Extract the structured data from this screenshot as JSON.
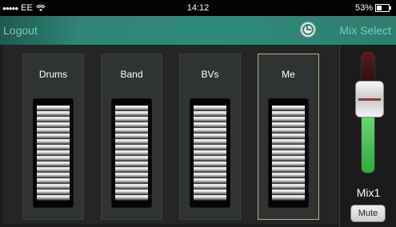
{
  "status_bar": {
    "carrier": "EE",
    "time": "14:12",
    "battery": "53%",
    "battery_level": 0.53
  },
  "top_bar": {
    "logout_label": "Logout",
    "mix_select_label": "Mix Select"
  },
  "channels": [
    {
      "name": "Drums",
      "selected": false
    },
    {
      "name": "Band",
      "selected": false
    },
    {
      "name": "BVs",
      "selected": false
    },
    {
      "name": "Me",
      "selected": true
    }
  ],
  "master": {
    "mix_name": "Mix1",
    "mute_label": "Mute",
    "meter_level": 0.46
  },
  "colors": {
    "accent_teal": "#2f8577",
    "meter_green": "#58c85e",
    "meter_red": "#5a1b1b"
  },
  "icons": {
    "wifi": "wifi-icon",
    "mix_select": "mix-select-icon"
  }
}
